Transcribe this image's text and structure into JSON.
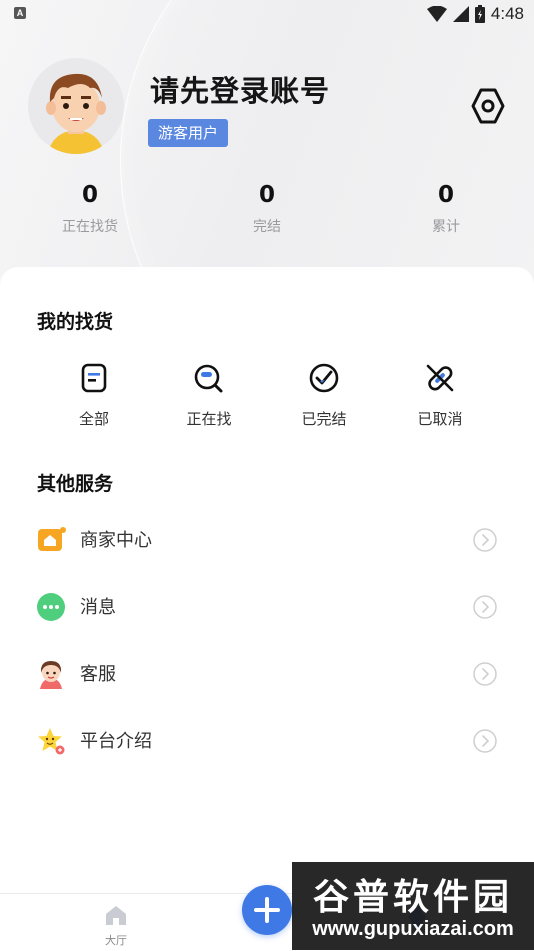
{
  "status_bar": {
    "left_indicator": "A",
    "time": "4:48"
  },
  "profile": {
    "username": "请先登录账号",
    "badge": "游客用户"
  },
  "stats": [
    {
      "value": "0",
      "label": "正在找货"
    },
    {
      "value": "0",
      "label": "完结"
    },
    {
      "value": "0",
      "label": "累计"
    }
  ],
  "my_orders": {
    "title": "我的找货",
    "items": [
      {
        "label": "全部",
        "icon": "document-icon"
      },
      {
        "label": "正在找",
        "icon": "search-icon"
      },
      {
        "label": "已完结",
        "icon": "check-circle-icon"
      },
      {
        "label": "已取消",
        "icon": "cancel-link-icon"
      }
    ]
  },
  "other_services": {
    "title": "其他服务",
    "items": [
      {
        "label": "商家中心",
        "icon": "shop-icon"
      },
      {
        "label": "消息",
        "icon": "chat-icon"
      },
      {
        "label": "客服",
        "icon": "customer-service-icon"
      },
      {
        "label": "平台介绍",
        "icon": "star-icon"
      }
    ]
  },
  "tabbar": {
    "home_label": "大厅"
  },
  "watermark": {
    "title": "谷普软件园",
    "url": "www.gupuxiazai.com"
  },
  "colors": {
    "accent": "#3f79e6",
    "badge": "#5a87e0"
  }
}
